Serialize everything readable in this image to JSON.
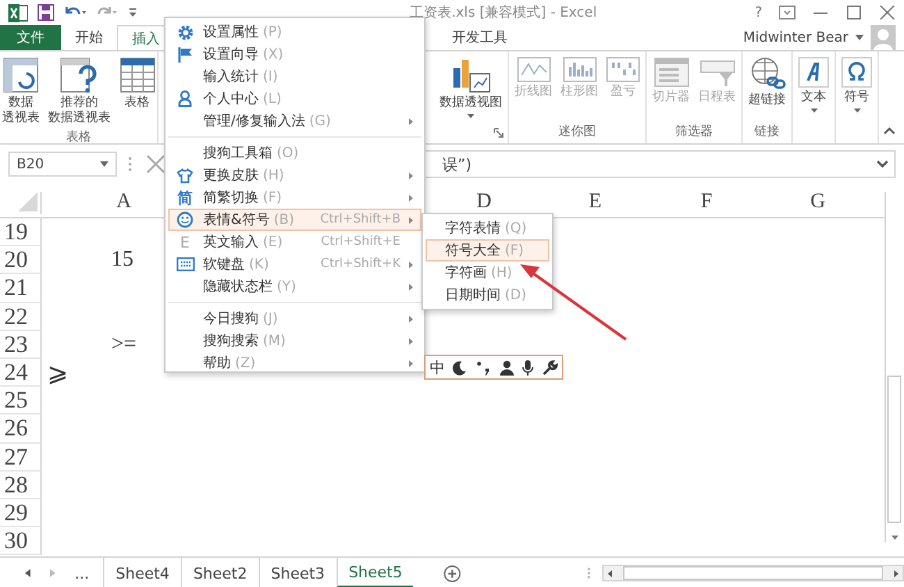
{
  "title_bar": {
    "title": "工资表.xls  [兼容模式] - Excel",
    "help": "?"
  },
  "ribbon_tabs": [
    {
      "label": "文件",
      "kind": "file",
      "selected": false
    },
    {
      "label": "开始",
      "kind": "tab",
      "selected": false
    },
    {
      "label": "插入",
      "kind": "tab",
      "selected": true
    },
    {
      "label": "开发工具",
      "kind": "tab",
      "selected": false
    }
  ],
  "account": {
    "name": "Midwinter Bear"
  },
  "ribbon_groups": [
    {
      "label": "表格",
      "buttons": [
        {
          "lines": [
            "数据",
            "透视表"
          ],
          "disabled": false
        },
        {
          "lines": [
            "推荐的",
            "数据透视表"
          ],
          "disabled": false
        },
        {
          "lines": [
            "表格"
          ],
          "disabled": false
        }
      ]
    },
    {
      "buttons": [
        {
          "lines": [
            "数据透视图"
          ],
          "disabled": false,
          "dropdown": true
        }
      ]
    },
    {
      "label": "迷你图",
      "buttons": [
        {
          "lines": [
            "折线图"
          ],
          "disabled": true
        },
        {
          "lines": [
            "柱形图"
          ],
          "disabled": true
        },
        {
          "lines": [
            "盈亏"
          ],
          "disabled": true
        }
      ]
    },
    {
      "label": "筛选器",
      "buttons": [
        {
          "lines": [
            "切片器"
          ],
          "disabled": true
        },
        {
          "lines": [
            "日程表"
          ],
          "disabled": true
        }
      ]
    },
    {
      "label": "链接",
      "buttons": [
        {
          "lines": [
            "超链接"
          ],
          "disabled": false
        }
      ]
    },
    {
      "buttons": [
        {
          "lines": [
            "文本"
          ],
          "disabled": false,
          "dropdown": true
        }
      ]
    },
    {
      "buttons": [
        {
          "lines": [
            "符号"
          ],
          "disabled": false,
          "dropdown": true
        }
      ]
    }
  ],
  "formula_bar": {
    "name_box": "B20",
    "formula": "误”)"
  },
  "columns": [
    {
      "label": "A"
    },
    {
      "label": "D"
    },
    {
      "label": "E"
    },
    {
      "label": "F"
    },
    {
      "label": "G"
    }
  ],
  "rows": [
    {
      "number": "19"
    },
    {
      "number": "20",
      "cell": {
        "text": "15",
        "kind": "value"
      }
    },
    {
      "number": "21"
    },
    {
      "number": "22"
    },
    {
      "number": "23",
      "cell": {
        "text": ">=",
        "kind": "value"
      }
    },
    {
      "number": "24",
      "cell": {
        "text": "⩾",
        "kind": "symbol"
      }
    },
    {
      "number": "25"
    },
    {
      "number": "26"
    },
    {
      "number": "27"
    },
    {
      "number": "28"
    },
    {
      "number": "29"
    },
    {
      "number": "30"
    }
  ],
  "sheet_tabs": {
    "overflow": "...",
    "tabs": [
      {
        "label": "Sheet4",
        "selected": false
      },
      {
        "label": "Sheet2",
        "selected": false
      },
      {
        "label": "Sheet3",
        "selected": false
      },
      {
        "label": "Sheet5",
        "selected": true
      }
    ]
  },
  "context_menu": {
    "sections": [
      {
        "items": [
          {
            "label": "设置属性",
            "key": "(P)",
            "selected": false
          },
          {
            "label": "设置向导",
            "key": "(X)",
            "selected": false
          },
          {
            "label": "输入统计",
            "key": "(I)",
            "selected": false
          },
          {
            "label": "个人中心",
            "key": "(L)",
            "selected": false
          },
          {
            "label": "管理/修复输入法",
            "key": "(G)",
            "selected": false,
            "submenu": true
          }
        ]
      },
      {
        "items": [
          {
            "label": "搜狗工具箱",
            "key": "(O)",
            "selected": false
          },
          {
            "label": "更换皮肤",
            "key": "(H)",
            "selected": false,
            "submenu": true
          },
          {
            "label": "简繁切换",
            "key": "(F)",
            "glyph": "简",
            "selected": false,
            "submenu": true
          },
          {
            "label": "表情&符号",
            "key": "(B)",
            "shortcut": "Ctrl+Shift+B",
            "selected": true,
            "submenu": true
          },
          {
            "label": "英文输入",
            "key": "(E)",
            "glyph": "E",
            "shortcut": "Ctrl+Shift+E",
            "selected": false
          },
          {
            "label": "软键盘",
            "key": "(K)",
            "shortcut": "Ctrl+Shift+K",
            "selected": false,
            "submenu": true
          },
          {
            "label": "隐藏状态栏",
            "key": "(Y)",
            "selected": false,
            "submenu": true
          }
        ]
      },
      {
        "items": [
          {
            "label": "今日搜狗",
            "key": "(J)",
            "selected": false,
            "submenu": true
          },
          {
            "label": "搜狗搜索",
            "key": "(M)",
            "selected": false,
            "submenu": true
          },
          {
            "label": "帮助",
            "key": "(Z)",
            "selected": false,
            "submenu": true
          }
        ]
      }
    ]
  },
  "submenu": {
    "items": [
      {
        "label": "字符表情",
        "key": "(Q)",
        "selected": false
      },
      {
        "label": "符号大全",
        "key": "(F)",
        "selected": true
      },
      {
        "label": "字符画",
        "key": "(H)",
        "selected": false
      },
      {
        "label": "日期时间",
        "key": "(D)",
        "selected": false
      }
    ]
  },
  "ime_status_bar": {
    "mode": "中"
  }
}
